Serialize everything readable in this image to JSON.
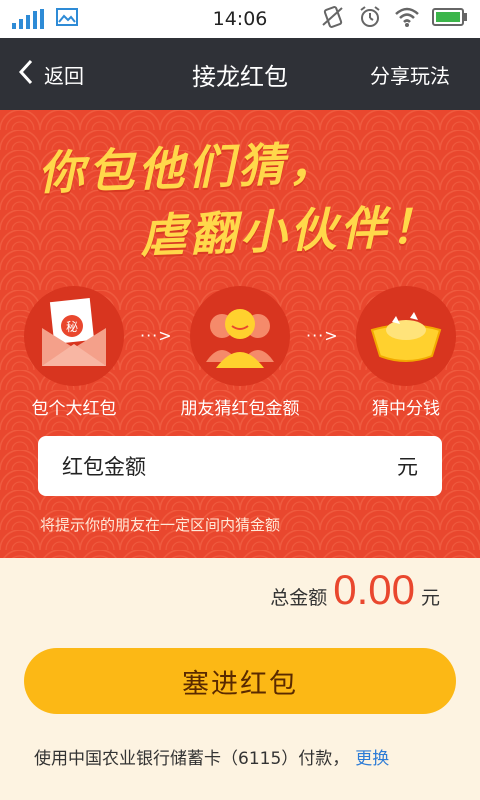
{
  "status_bar": {
    "time": "14:06"
  },
  "nav": {
    "back_label": "返回",
    "title": "接龙红包",
    "share_label": "分享玩法"
  },
  "hero": {
    "headline_line1": "你包他们猜，",
    "headline_line2": "虐翻小伙伴！",
    "steps": [
      {
        "label": "包个大红包",
        "badge": "秘"
      },
      {
        "label": "朋友猜红包金额"
      },
      {
        "label": "猜中分钱"
      }
    ],
    "arrow_text": "···>"
  },
  "amount": {
    "label": "红包金额",
    "unit": "元",
    "hint": "将提示你的朋友在一定区间内猜金额"
  },
  "total": {
    "label": "总金额",
    "value": "0.00",
    "unit": "元"
  },
  "submit_label": "塞进红包",
  "payment": {
    "text": "使用中国农业银行储蓄卡（6115）付款，",
    "change_label": "更换"
  },
  "colors": {
    "hero_red": "#e9472e",
    "accent_yellow": "#fcb815",
    "navbar": "#2f3137",
    "headline_yellow": "#ffd84a",
    "link_blue": "#2e7cd6"
  }
}
